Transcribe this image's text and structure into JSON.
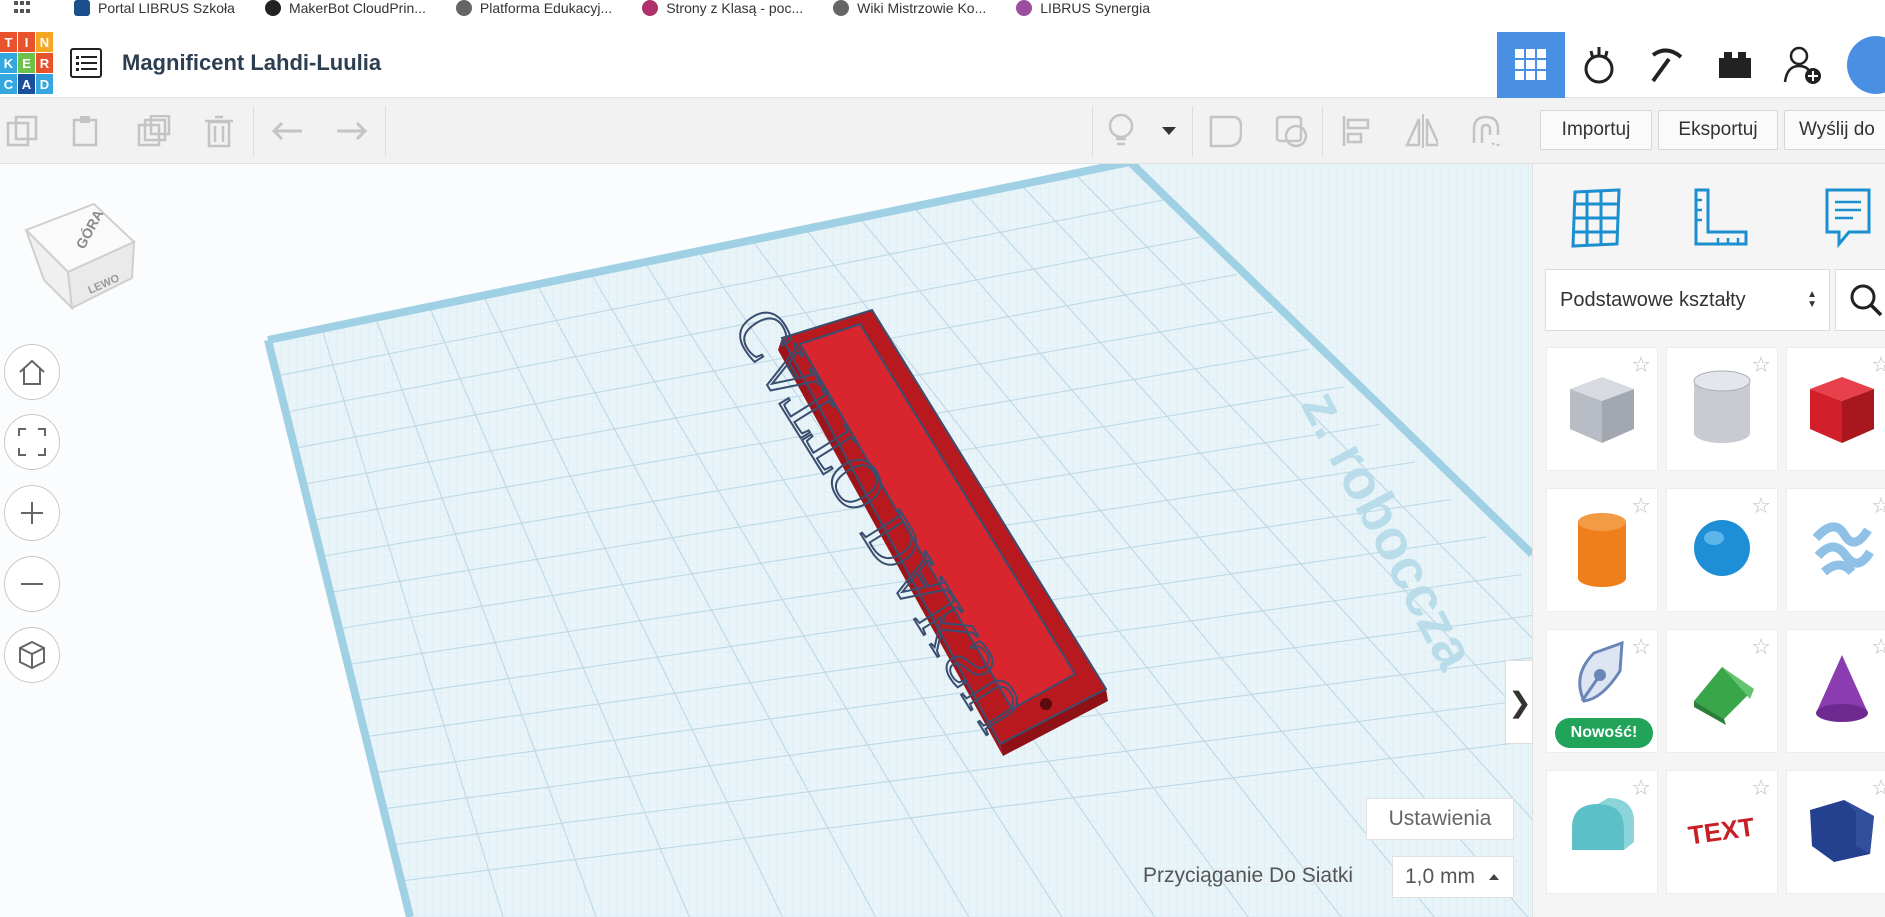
{
  "bookmarks": [
    {
      "label": "Portal LIBRUS Szkoła",
      "color": "#1a4f8b"
    },
    {
      "label": "MakerBot CloudPrin...",
      "color": "#222222"
    },
    {
      "label": "Platforma Edukacyj...",
      "color": "#666666"
    },
    {
      "label": "Strony z Klasą - poc...",
      "color": "#b0306a"
    },
    {
      "label": "Wiki Mistrzowie Ko...",
      "color": "#666666"
    },
    {
      "label": "LIBRUS Synergia",
      "color": "#9b4da0"
    }
  ],
  "logo": {
    "letters": [
      "T",
      "I",
      "N",
      "K",
      "E",
      "R",
      "C",
      "A",
      "D"
    ],
    "colors": [
      "#e8532d",
      "#e8532d",
      "#f5a623",
      "#35a7e0",
      "#6dc24b",
      "#e8532d",
      "#35a7e0",
      "#1b4f9c",
      "#35a7e0"
    ]
  },
  "header": {
    "title": "Magnificent Lahdi-Luulia",
    "accent": "#4a90e2"
  },
  "toolbar": {
    "import": "Importuj",
    "export": "Eksportuj",
    "send": "Wyślij do"
  },
  "workplane": {
    "cube_top": "GÓRA",
    "cube_side": "LEWO",
    "object_text": "CATTO DAKSU",
    "watermark": "z. roboccza",
    "object_color": "#d9252e",
    "settings": "Ustawienia",
    "snap_label": "Przyciąganie Do Siatki",
    "snap_value": "1,0 mm",
    "collapse": "❯"
  },
  "panel": {
    "category": "Podstawowe kształty",
    "new_badge": "Nowość!",
    "tiles": [
      {
        "name": "box-hole",
        "color": "#b8bcc4"
      },
      {
        "name": "cylinder-hole",
        "color": "#c8ccd2"
      },
      {
        "name": "box",
        "color": "#d21f2a"
      },
      {
        "name": "cylinder",
        "color": "#ef7f1a"
      },
      {
        "name": "sphere",
        "color": "#1e8fd6"
      },
      {
        "name": "scribble",
        "color": "#8fc1e6"
      },
      {
        "name": "shape-generator",
        "color": "#6a86b8"
      },
      {
        "name": "roof",
        "color": "#3aa64a"
      },
      {
        "name": "cone",
        "color": "#8a3cb0"
      },
      {
        "name": "round-roof",
        "color": "#5cc0c8"
      },
      {
        "name": "text",
        "color": "#c81e24"
      },
      {
        "name": "polygon",
        "color": "#25408f"
      }
    ]
  }
}
